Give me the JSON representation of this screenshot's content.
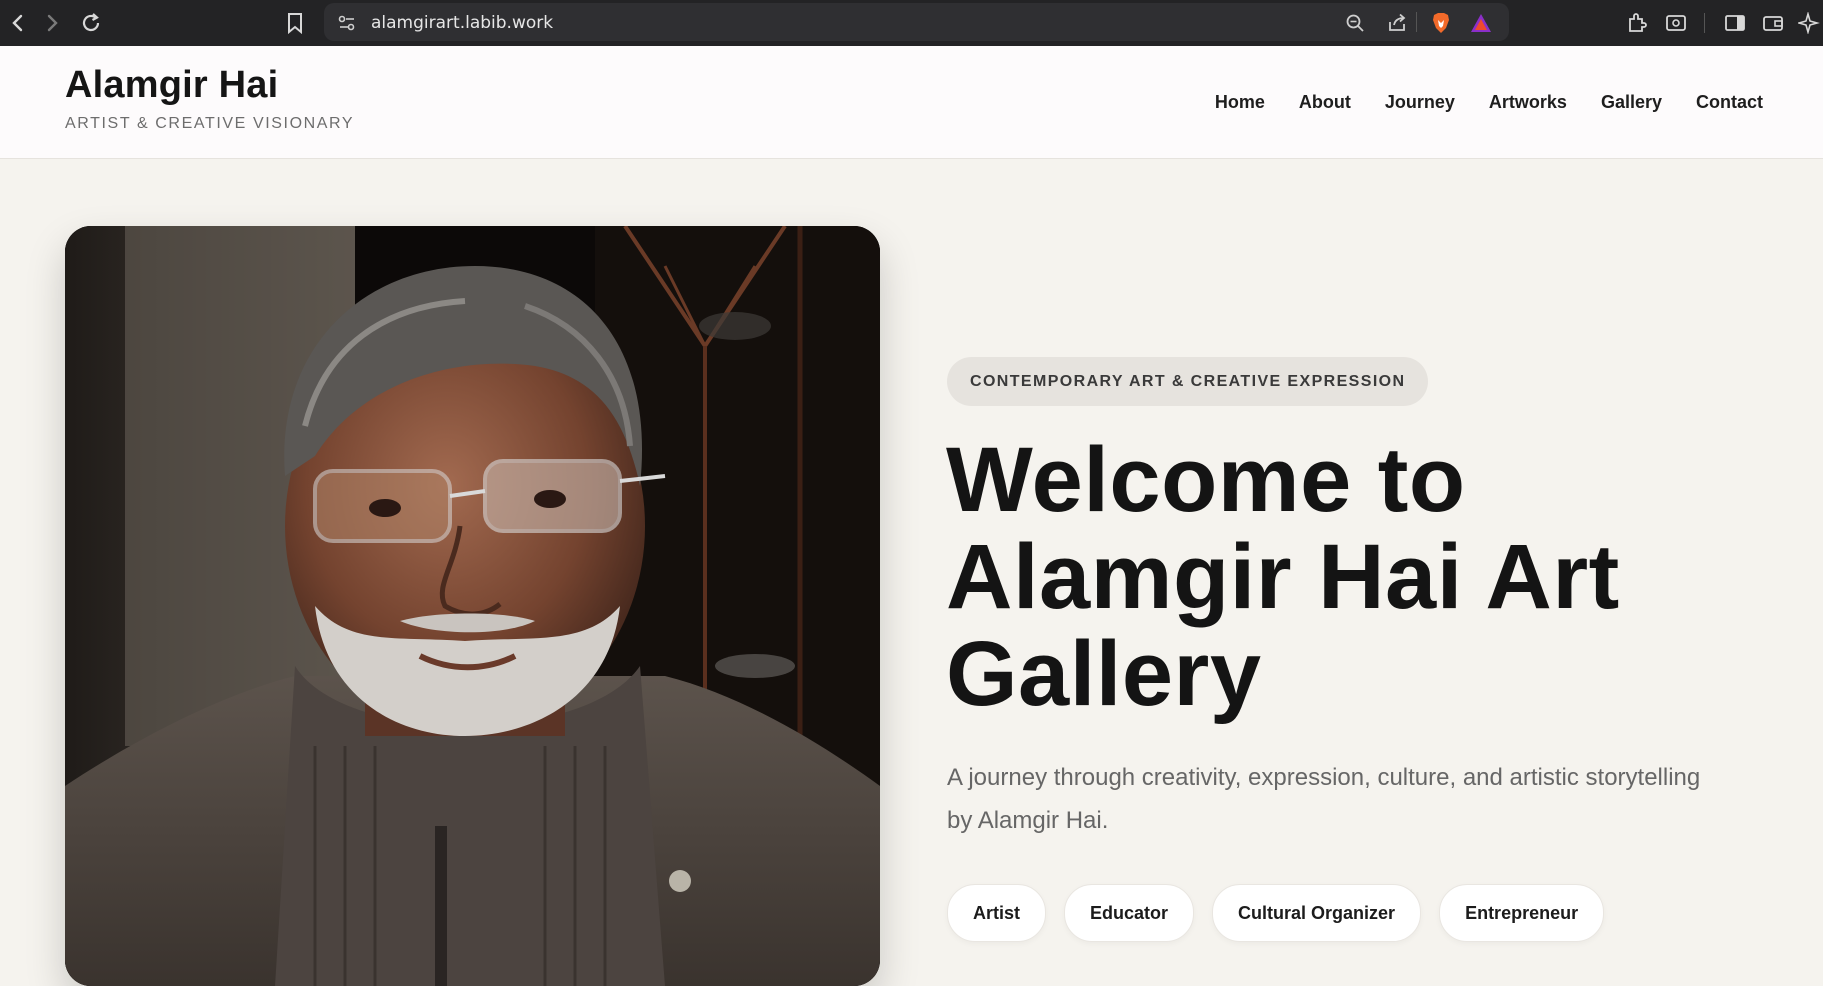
{
  "browser": {
    "url": "alamgirart.labib.work",
    "accent": "#c8a84a"
  },
  "site": {
    "brand": "Alamgir Hai",
    "tagline": "ARTIST & CREATIVE VISIONARY"
  },
  "nav": [
    {
      "label": "Home"
    },
    {
      "label": "About"
    },
    {
      "label": "Journey"
    },
    {
      "label": "Artworks"
    },
    {
      "label": "Gallery"
    },
    {
      "label": "Contact"
    }
  ],
  "hero": {
    "kicker": "CONTEMPORARY ART & CREATIVE EXPRESSION",
    "title": "Welcome to Alamgir Hai Art Gallery",
    "subtitle": "A journey through creativity, expression, culture, and artistic storytelling by Alamgir Hai.",
    "roles": [
      "Artist",
      "Educator",
      "Cultural Organizer",
      "Entrepreneur"
    ]
  },
  "colors": {
    "page_bg": "#f5f3ee",
    "header_bg": "#fdfbfc",
    "chrome_bg": "#232325",
    "text": "#141414"
  }
}
